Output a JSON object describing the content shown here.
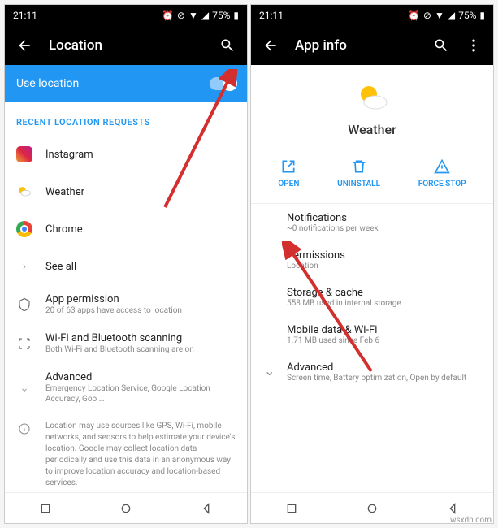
{
  "status": {
    "time": "21:11",
    "battery": "75%"
  },
  "left": {
    "title": "Location",
    "useLocation": "Use location",
    "sectionHeader": "RECENT LOCATION REQUESTS",
    "apps": [
      "Instagram",
      "Weather",
      "Chrome"
    ],
    "seeAll": "See all",
    "perm": {
      "label": "App permission",
      "sub": "20 of 63 apps have access to location"
    },
    "scan": {
      "label": "Wi-Fi and Bluetooth scanning",
      "sub": "Both Wi-Fi and Bluetooth scanning are on"
    },
    "adv": {
      "label": "Advanced",
      "sub": "Emergency Location Service, Google Location Accuracy, Goo …"
    },
    "desc": "Location may use sources like GPS, Wi-Fi, mobile networks, and sensors to help estimate your device's location. Google may collect location data periodically and use this data in an anonymous way to improve location accuracy and location-based services."
  },
  "right": {
    "title": "App info",
    "appName": "Weather",
    "actions": {
      "open": "OPEN",
      "uninstall": "UNINSTALL",
      "force": "FORCE STOP"
    },
    "rows": {
      "notif": {
        "label": "Notifications",
        "sub": "~0 notifications per week"
      },
      "perm": {
        "label": "Permissions",
        "sub": "Location"
      },
      "storage": {
        "label": "Storage & cache",
        "sub": "558 MB used in internal storage"
      },
      "data": {
        "label": "Mobile data & Wi-Fi",
        "sub": "1.71 MB used since Feb 6"
      },
      "adv": {
        "label": "Advanced",
        "sub": "Screen time, Battery optimization, Open by default"
      }
    }
  },
  "watermark": "wsxdn.com"
}
